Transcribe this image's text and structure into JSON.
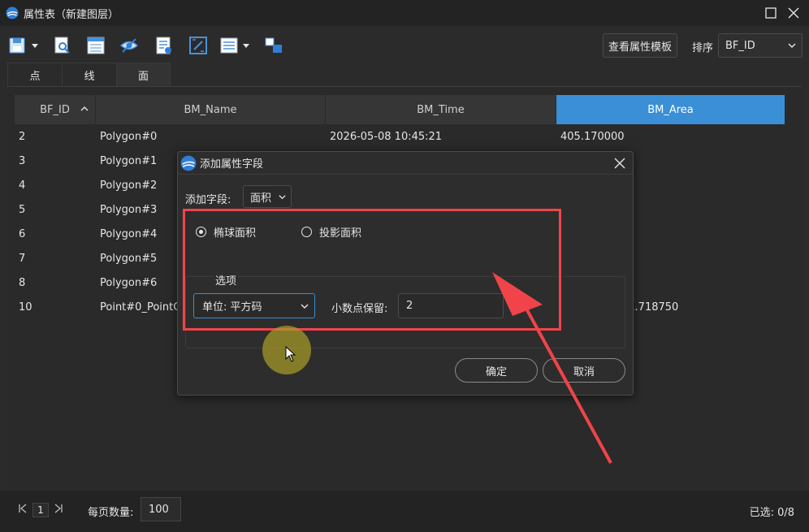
{
  "window": {
    "title": "属性表（新建图层）"
  },
  "toolbar": {
    "icons": [
      "save-icon",
      "search-doc-icon",
      "table-icon",
      "eye-hide-icon",
      "add-field-icon",
      "calculator-icon",
      "list-icon",
      "layers-icon"
    ],
    "template_btn": "查看属性模板",
    "sort_label": "排序",
    "sort_value": "BF_ID"
  },
  "tabs": [
    {
      "label": "点"
    },
    {
      "label": "线"
    },
    {
      "label": "面"
    }
  ],
  "table": {
    "columns": [
      "BF_ID",
      "BM_Name",
      "BM_Time",
      "BM_Area"
    ],
    "rows": [
      [
        "2",
        "Polygon#0",
        "2026-05-08 10:45:21",
        "405.170000"
      ],
      [
        "3",
        "Polygon#1",
        "",
        ""
      ],
      [
        "4",
        "Polygon#2",
        "",
        ""
      ],
      [
        "5",
        "Polygon#3",
        "",
        ""
      ],
      [
        "6",
        "Polygon#4",
        "",
        ""
      ],
      [
        "7",
        "Polygon#5",
        "",
        ""
      ],
      [
        "8",
        "Polygon#6",
        "",
        ""
      ],
      [
        "10",
        "Point#0_PointG",
        "",
        "51.718750"
      ]
    ]
  },
  "footer": {
    "page": "1",
    "per_page_label": "每页数量:",
    "per_page_value": "100",
    "selected": "已选: 0/8"
  },
  "dialog": {
    "title": "添加属性字段",
    "add_field_label": "添加字段:",
    "field_value": "面积",
    "radio1": "椭球面积",
    "radio2": "投影面积",
    "radio_selected": "椭球面积",
    "options_label": "选项",
    "unit_value": "单位: 平方码",
    "decimal_label": "小数点保留:",
    "decimal_value": "2",
    "ok": "确定",
    "cancel": "取消"
  },
  "colors": {
    "accent": "#3a8fd6",
    "highlight": "#f0444a",
    "background": "#2b2b2b"
  }
}
